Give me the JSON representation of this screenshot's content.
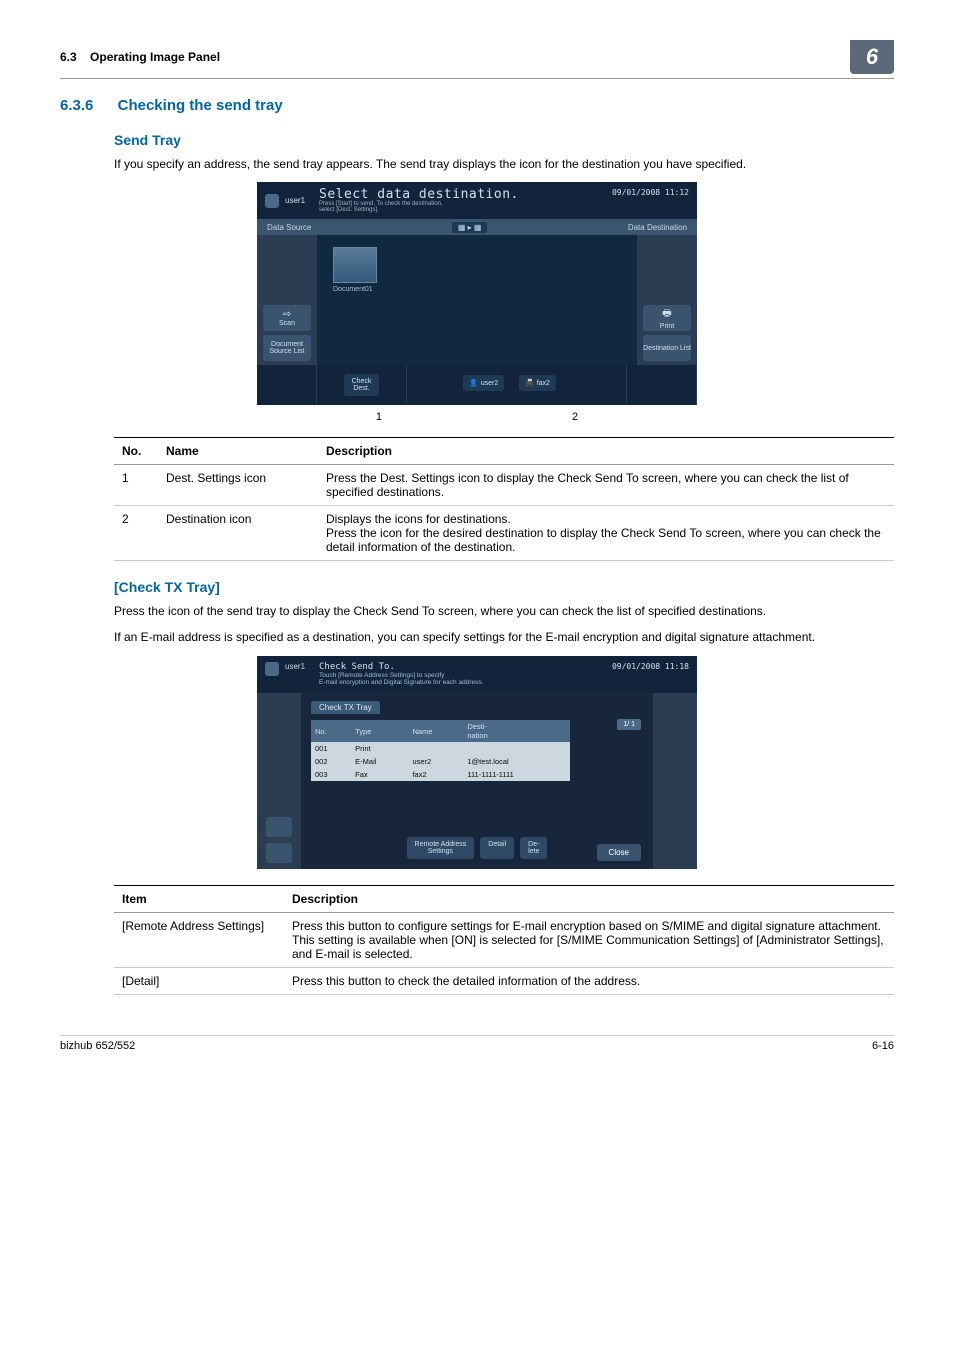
{
  "header": {
    "section_ref": "6.3",
    "section_name": "Operating Image Panel",
    "chapter_num": "6"
  },
  "sec636": {
    "num": "6.3.6",
    "title": "Checking the send tray",
    "sendtray_title": "Send Tray",
    "sendtray_body": "If you specify an address, the send tray appears. The send tray displays the icon for the destination you have specified.",
    "callout1": "1",
    "callout2": "2"
  },
  "screen1": {
    "user": "user1",
    "bigtitle": "Select data destination.",
    "sub1": "Press [Start] to send. To check the destination,",
    "sub2": "select [Dest. Settings].",
    "datetime": "09/01/2008  11:12",
    "bar_left": "Data Source",
    "bar_right": "Data Destination",
    "thumb_label": "Document01",
    "left_btn_top": "Scan",
    "left_btn_bot": "Document\nSource List",
    "strip_chip1": "Check\nDest.",
    "strip_chip_user": "user2",
    "strip_chip_fax": "fax2",
    "right_btn_top": "Print",
    "right_btn_bot": "Destination List"
  },
  "table1": {
    "head_no": "No.",
    "head_name": "Name",
    "head_desc": "Description",
    "rows": [
      {
        "no": "1",
        "name": "Dest. Settings icon",
        "desc": "Press the Dest. Settings icon to display the Check Send To screen, where you can check the list of specified destinations."
      },
      {
        "no": "2",
        "name": "Destination icon",
        "desc": "Displays the icons for destinations.\nPress the icon for the desired destination to display the Check Send To screen, where you can check the detail information of the destination."
      }
    ]
  },
  "checktx": {
    "title": "[Check TX Tray]",
    "body1": "Press the icon of the send tray to display the Check Send To screen, where you can check the list of specified destinations.",
    "body2": "If an E-mail address is specified as a destination, you can specify settings for the E-mail encryption and digital signature attachment."
  },
  "screen2": {
    "user": "user1",
    "title": "Check Send To.",
    "sub1": "Touch [Remote Address Settings] to specify",
    "sub2": "E-mail encryption and Digital Signature for each address.",
    "datetime": "09/01/2008  11:18",
    "tab": "Check TX Tray",
    "page": "1/  1",
    "th_no": "No.",
    "th_type": "Type",
    "th_name": "Name",
    "th_dest": "Desti-\nnation",
    "rows": [
      {
        "no": "001",
        "type": "Print",
        "name": "",
        "dest": ""
      },
      {
        "no": "002",
        "type": "E-Mail",
        "name": "user2",
        "dest": "1@test.local"
      },
      {
        "no": "003",
        "type": "Fax",
        "name": "fax2",
        "dest": "111-1111-1111"
      }
    ],
    "btn_remote": "Remote Address\nSettings",
    "btn_detail": "Detail",
    "btn_delete": "De-\nlete",
    "btn_close": "Close"
  },
  "table2": {
    "head_item": "Item",
    "head_desc": "Description",
    "rows": [
      {
        "item": "[Remote Address Settings]",
        "desc": "Press this button to configure settings for E-mail encryption based on S/MIME and digital signature attachment.\nThis setting is available when [ON] is selected for [S/MIME Communication Settings] of [Administrator Settings], and E-mail is selected."
      },
      {
        "item": "[Detail]",
        "desc": "Press this button to check the detailed information of the address."
      }
    ]
  },
  "footer": {
    "left": "bizhub 652/552",
    "right": "6-16"
  }
}
